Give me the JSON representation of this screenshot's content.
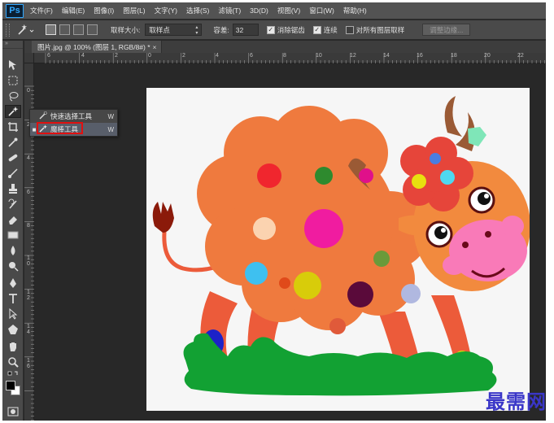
{
  "app": {
    "logo": "Ps"
  },
  "menu": [
    "文件(F)",
    "编辑(E)",
    "图像(I)",
    "图层(L)",
    "文字(Y)",
    "选择(S)",
    "滤镜(T)",
    "3D(D)",
    "视图(V)",
    "窗口(W)",
    "帮助(H)"
  ],
  "options": {
    "tool_icon": "magic-wand-icon",
    "sample_size_label": "取样大小:",
    "sample_size_value": "取样点",
    "tolerance_label": "容差:",
    "tolerance_value": "32",
    "antialias_label": "消除锯齿",
    "antialias_checked": true,
    "contiguous_label": "连续",
    "contiguous_checked": true,
    "sample_all_label": "对所有图层取样",
    "sample_all_checked": false,
    "refine_edge_label": "调整边缘..."
  },
  "document": {
    "tab_title": "图片.jpg @ 100% (图层 1, RGB/8#) *",
    "close_glyph": "×"
  },
  "ruler": {
    "top": [
      "6",
      "4",
      "2",
      "0",
      "2",
      "4",
      "6",
      "8",
      "10",
      "12",
      "14",
      "16",
      "18",
      "20",
      "22"
    ],
    "left": [
      "0",
      "2",
      "4",
      "6",
      "8",
      "1 0",
      "1 2",
      "1 4",
      "1 6"
    ]
  },
  "flyout": {
    "items": [
      {
        "label": "快速选择工具",
        "key": "W",
        "icon": "quick-selection-icon",
        "selected": false
      },
      {
        "label": "魔棒工具",
        "key": "W",
        "icon": "magic-wand-icon",
        "selected": true
      }
    ]
  },
  "tools": [
    "move-icon",
    "marquee-icon",
    "lasso-icon",
    "magic-wand-icon",
    "crop-icon",
    "eyedropper-icon",
    "healing-brush-icon",
    "brush-icon",
    "clone-stamp-icon",
    "history-brush-icon",
    "eraser-icon",
    "gradient-icon",
    "blur-icon",
    "dodge-icon",
    "pen-icon",
    "type-icon",
    "path-selection-icon",
    "shape-icon",
    "hand-icon",
    "zoom-icon",
    "swap-colors-icon",
    "foreground-color",
    "quick-mask-icon"
  ],
  "colors": {
    "foreground": "#000000",
    "background": "#ffffff",
    "body": "#ef7a3e",
    "body_light": "#f08a4a",
    "head": "#f28a3e",
    "legs": "#ec5b3a",
    "horn": "#9a5a35",
    "grass": "#12a133",
    "muzzle": "#f97ab8",
    "tail_tuft": "#8b1a0a"
  },
  "watermark": "最需网"
}
